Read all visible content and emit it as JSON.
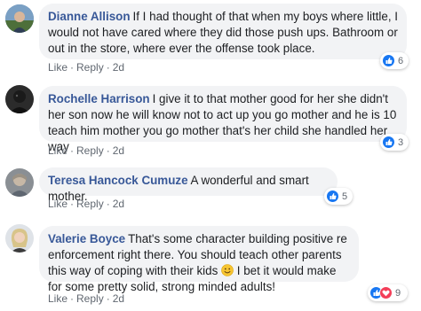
{
  "comments": [
    {
      "author": "Dianne Allison",
      "text": "If I had thought of that when my boys where little, I would not have cared where they did those push ups. Bathroom or out in the store, where ever the offense took place.",
      "like": "Like",
      "reply": "Reply",
      "time": "2d",
      "reaction_count": "6",
      "reactions": [
        "like-icon"
      ]
    },
    {
      "author": "Rochelle Harrison",
      "text": "I give it to that mother good for her she didn't her son now he will know not to act up you go mother and he is 10 teach him mother you go mother that's her child she handled her way",
      "like": "Like",
      "reply": "Reply",
      "time": "2d",
      "reaction_count": "3",
      "reactions": [
        "like-icon"
      ]
    },
    {
      "author": "Teresa Hancock Cumuze",
      "text": "A wonderful and smart mother.",
      "like": "Like",
      "reply": "Reply",
      "time": "2d",
      "reaction_count": "5",
      "reactions": [
        "like-icon"
      ]
    },
    {
      "author": "Valerie Boyce",
      "text_before_emoji": "That's some character building positive re enforcement right there. You should teach other parents this way of coping with their kids",
      "emoji": "smiley-emoji",
      "text_after_emoji": "I bet it would make for some pretty solid, strong minded adults!",
      "like": "Like",
      "reply": "Reply",
      "time": "2d",
      "reaction_count": "9",
      "reactions": [
        "like-icon",
        "love-icon"
      ]
    }
  ],
  "separator": "·",
  "colors": {
    "author": "#385898",
    "bubble": "#f2f3f5",
    "meta": "#606770",
    "like": "#1877f2",
    "love": "#f33e58"
  }
}
